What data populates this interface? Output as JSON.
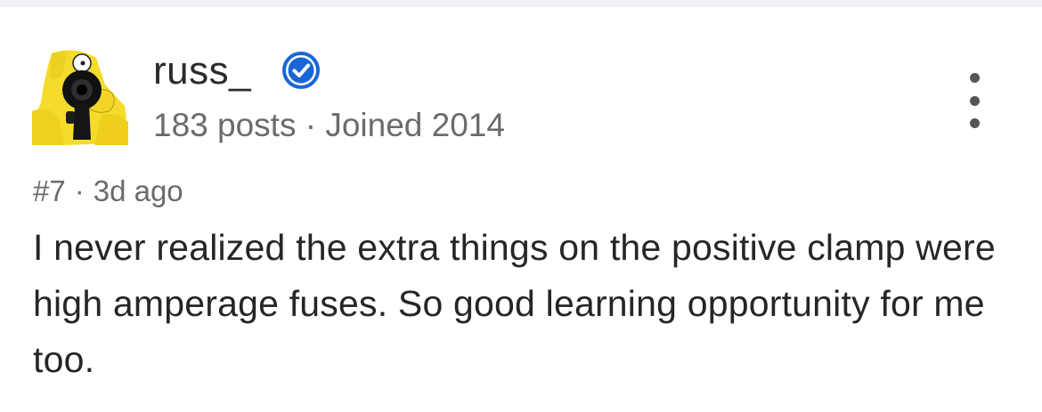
{
  "user": {
    "name": "russ_",
    "post_count": "183 posts",
    "separator": "·",
    "joined": "Joined 2014",
    "avatar_icon": "homer-simpson-aiming-gun-avatar",
    "verified_icon": "verified-check-icon",
    "verified_color": "#1a66d6"
  },
  "post": {
    "number": "#7",
    "separator": "·",
    "age": "3d ago",
    "body": "I never realized the extra things on the positive clamp were high amperage fuses. So good learning opportunity for me too."
  },
  "menu": {
    "icon": "more-vertical-icon"
  }
}
